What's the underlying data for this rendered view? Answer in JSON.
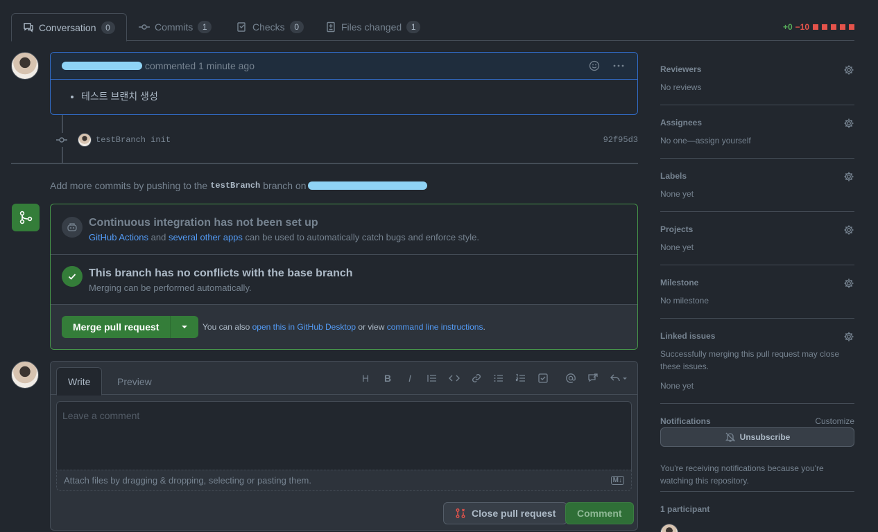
{
  "tabs": [
    {
      "label": "Conversation",
      "count": "0"
    },
    {
      "label": "Commits",
      "count": "1"
    },
    {
      "label": "Checks",
      "count": "0"
    },
    {
      "label": "Files changed",
      "count": "1"
    }
  ],
  "diffstat": {
    "added": "+0",
    "removed": "−10"
  },
  "comment": {
    "meta": "commented 1 minute ago",
    "body_item": "테스트 브랜치 생성"
  },
  "commit": {
    "message": "testBranch init",
    "sha": "92f95d3"
  },
  "push_hint": {
    "prefix": "Add more commits by pushing to the",
    "branch": "testBranch",
    "suffix": "branch on"
  },
  "merge": {
    "ci_title": "Continuous integration has not been set up",
    "ci_link1": "GitHub Actions",
    "ci_and": "and",
    "ci_link2": "several other apps",
    "ci_rest": "can be used to automatically catch bugs and enforce style.",
    "conflict_title": "This branch has no conflicts with the base branch",
    "conflict_sub": "Merging can be performed automatically.",
    "button": "Merge pull request",
    "also_prefix": "You can also",
    "also_link1": "open this in GitHub Desktop",
    "also_mid": "or view",
    "also_link2": "command line instructions",
    "also_end": "."
  },
  "new_comment": {
    "tab_write": "Write",
    "tab_preview": "Preview",
    "placeholder": "Leave a comment",
    "attach": "Attach files by dragging & dropping, selecting or pasting them.",
    "close_button": "Close pull request",
    "comment_button": "Comment",
    "toolbar_heading": "H",
    "toolbar_bold": "B",
    "toolbar_italic": "I",
    "markdown_badge": "M↓"
  },
  "sidebar": {
    "reviewers": {
      "title": "Reviewers",
      "value": "No reviews"
    },
    "assignees": {
      "title": "Assignees",
      "value": "No one—assign yourself"
    },
    "labels": {
      "title": "Labels",
      "value": "None yet"
    },
    "projects": {
      "title": "Projects",
      "value": "None yet"
    },
    "milestone": {
      "title": "Milestone",
      "value": "No milestone"
    },
    "linked": {
      "title": "Linked issues",
      "desc": "Successfully merging this pull request may close these issues.",
      "value": "None yet"
    },
    "notifications": {
      "title": "Notifications",
      "customize": "Customize",
      "button": "Unsubscribe",
      "desc": "You're receiving notifications because you're watching this repository."
    },
    "participants": {
      "title": "1 participant"
    }
  },
  "colors": {
    "accent_green": "#347d39",
    "link": "#539bf5",
    "danger": "#e5534b"
  }
}
